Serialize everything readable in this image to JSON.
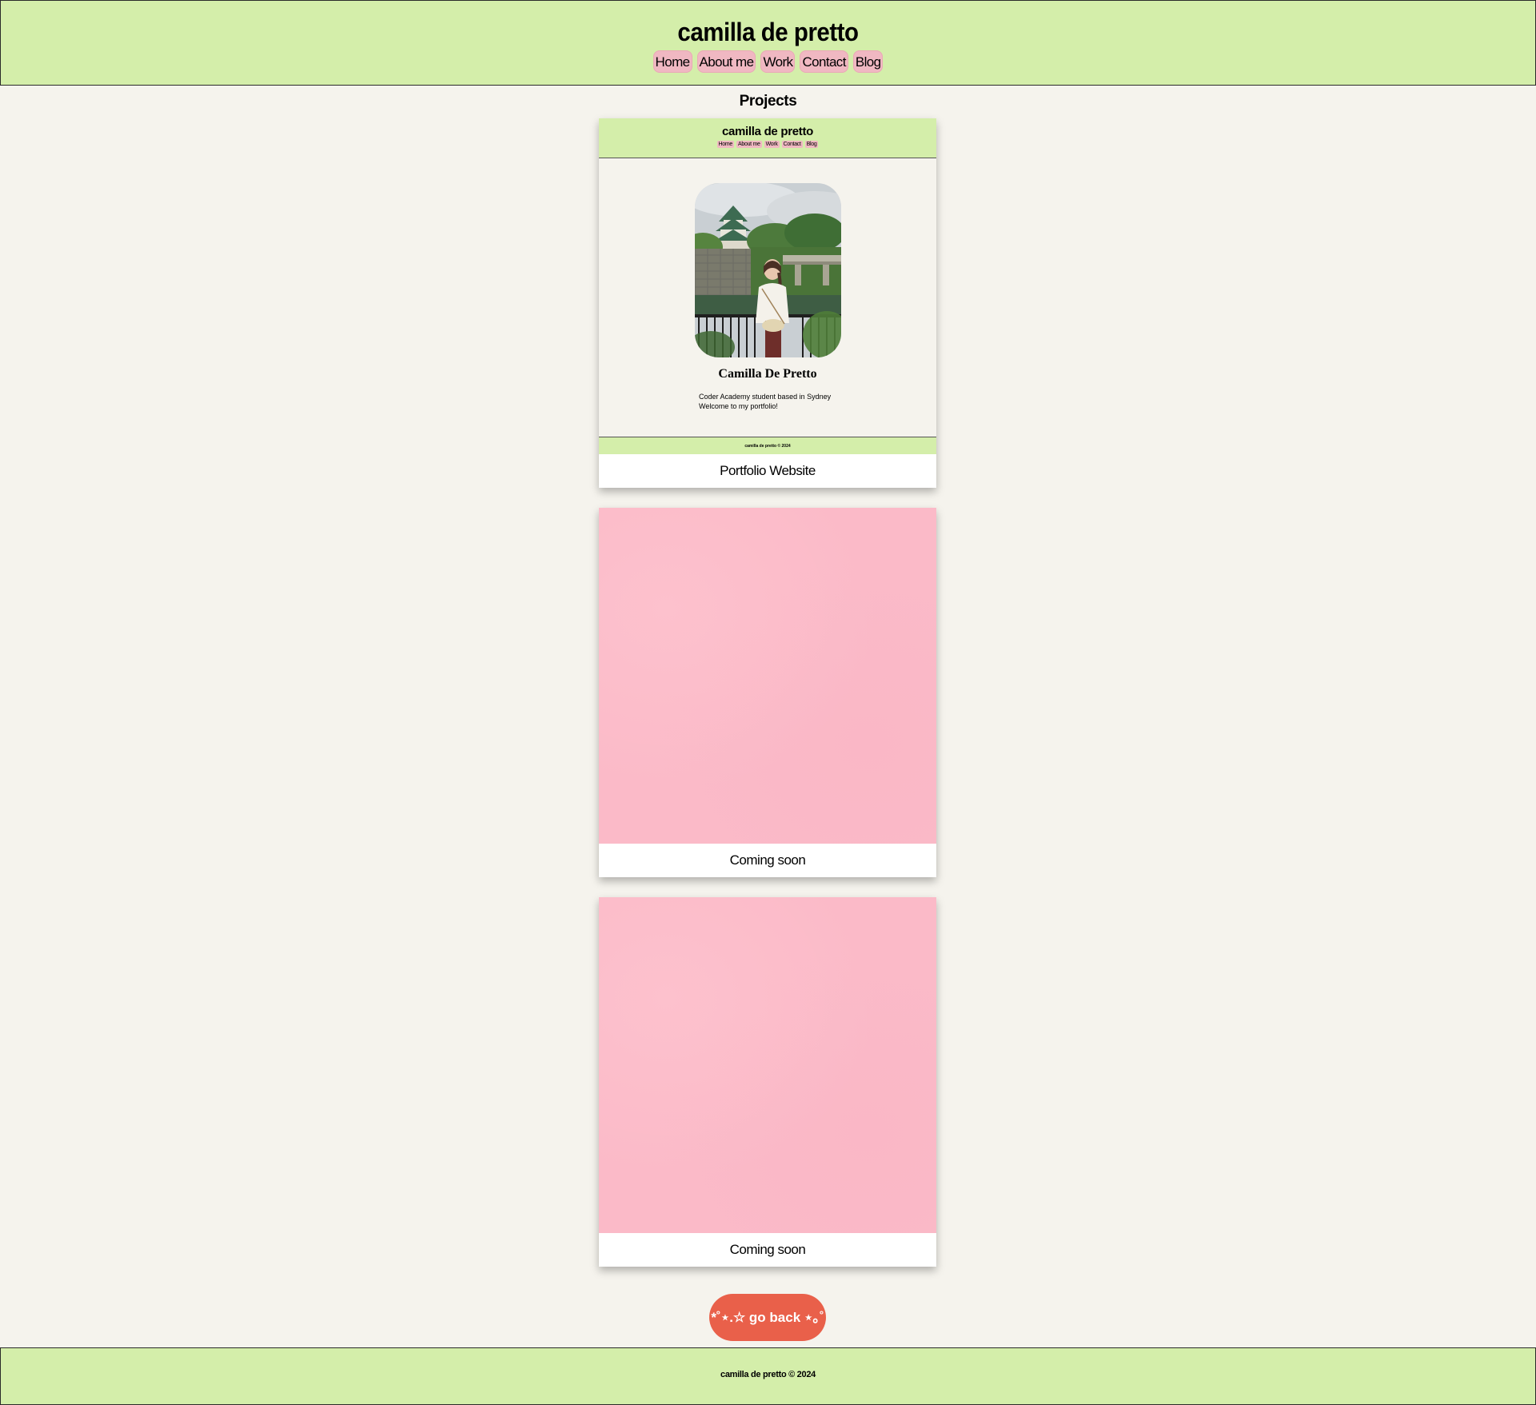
{
  "header": {
    "title": "camilla de pretto",
    "nav": [
      "Home",
      "About me",
      "Work",
      "Contact",
      "Blog"
    ]
  },
  "main": {
    "heading": "Projects",
    "cards": [
      {
        "caption": "Portfolio Website",
        "preview": {
          "title": "camilla de pretto",
          "nav": [
            "Home",
            "About me",
            "Work",
            "Contact",
            "Blog"
          ],
          "name": "Camilla De Pretto",
          "description_line1": "Coder Academy student based in Sydney",
          "description_line2": "Welcome to my portfolio!",
          "footer": "camilla de pretto © 2024"
        }
      },
      {
        "caption": "Coming soon"
      },
      {
        "caption": "Coming soon"
      }
    ],
    "go_back_label": "*˚⋆.☆ go back ⋆｡˚"
  },
  "footer": {
    "text": "camilla de pretto © 2024"
  },
  "colors": {
    "background": "#f5f3ed",
    "header_green": "#d4eeaa",
    "nav_pink": "#f0b8c2",
    "placeholder_pink": "#fbbac8",
    "button_coral": "#e9604a"
  }
}
